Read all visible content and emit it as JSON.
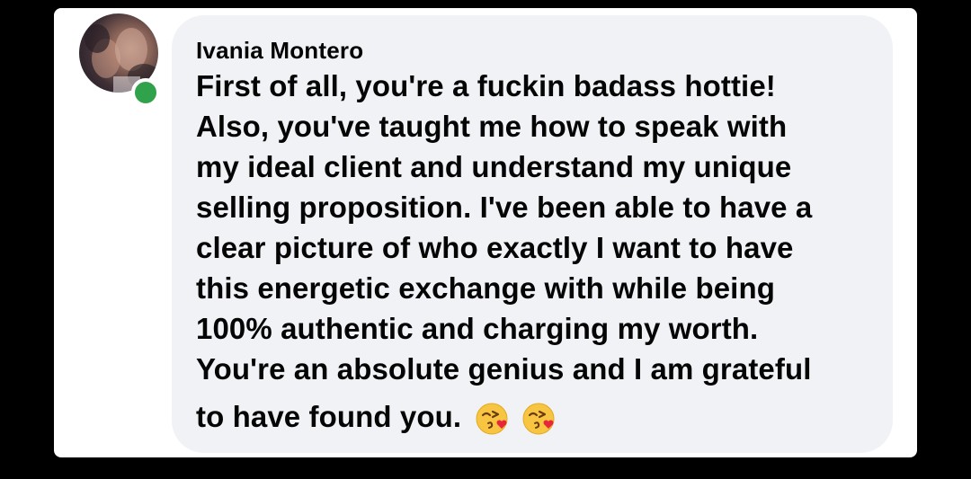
{
  "comment": {
    "author": "Ivania Montero",
    "online": true,
    "lines": [
      "First of all, you're a fuckin badass hottie!",
      "Also, you've taught me how to speak with",
      "my ideal client and understand my unique",
      "selling proposition. I've been able to have a",
      "clear picture of who exactly I want to have",
      "this energetic exchange with while being",
      "100% authentic and charging my worth.",
      "You're an absolute genius and I am grateful",
      "to have found you."
    ],
    "emojis": [
      "kissing-heart-emoji",
      "kissing-heart-emoji"
    ]
  },
  "colors": {
    "background": "#000000",
    "card": "#ffffff",
    "bubble": "#f0f2f5",
    "text": "#050505",
    "online": "#31a24c",
    "emoji_face": "#f7c542",
    "emoji_heart": "#e8263b"
  }
}
